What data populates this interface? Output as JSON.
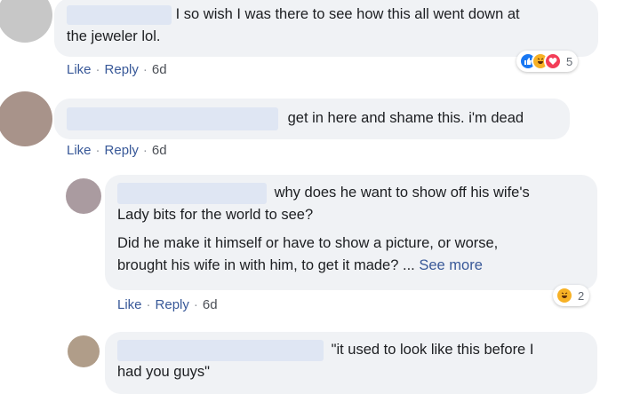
{
  "comments": [
    {
      "text_line1": "I so wish I was there to see how this all went down at",
      "text_line2": "the jeweler lol.",
      "like": "Like",
      "reply": "Reply",
      "time": "6d",
      "reactions": [
        "like-icon",
        "haha-icon",
        "love-icon"
      ],
      "reaction_count": "5"
    },
    {
      "text_line1": "get in here and shame this. i'm dead",
      "like": "Like",
      "reply": "Reply",
      "time": "6d"
    }
  ],
  "replies": [
    {
      "text_line1": "why does he want to show off his wife's",
      "text_line2": "Lady bits for the world to see?",
      "text_line3": "Did he make it himself or have to show a picture, or worse,",
      "text_line4": "brought his wife in with him, to get it made? ...",
      "see_more": "See more",
      "like": "Like",
      "reply": "Reply",
      "time": "6d",
      "reactions": [
        "haha-icon"
      ],
      "reaction_count": "2"
    },
    {
      "text_line1": "\"it used to look like this before I",
      "text_line2": "had you guys\""
    }
  ],
  "separator": "·",
  "colors": {
    "bubble": "#f0f2f5",
    "link": "#385898",
    "like_blue": "#1877f2",
    "love_red": "#f33e58",
    "haha_yellow": "#f7b125"
  }
}
